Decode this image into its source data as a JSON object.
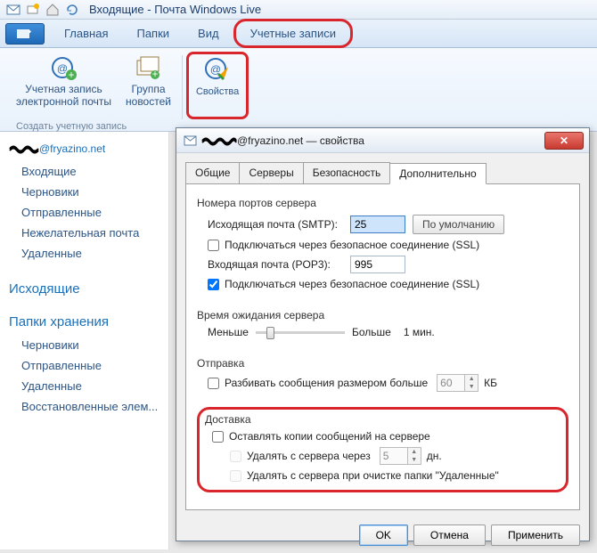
{
  "app_title": "Входящие - Почта Windows Live",
  "tabs": {
    "home": "Главная",
    "folders": "Папки",
    "view": "Вид",
    "accounts": "Учетные записи"
  },
  "ribbon": {
    "email_account": "Учетная запись\nэлектронной почты",
    "newsgroup": "Группа\nновостей",
    "properties": "Свойства",
    "group_title": "Создать учетную запись"
  },
  "sidebar": {
    "account": "@fryazino.net",
    "inbox": "Входящие",
    "drafts": "Черновики",
    "sent": "Отправленные",
    "junk": "Нежелательная почта",
    "deleted": "Удаленные",
    "outbox_section": "Исходящие",
    "storage_section": "Папки хранения",
    "s_drafts": "Черновики",
    "s_sent": "Отправленные",
    "s_deleted": "Удаленные",
    "s_restored": "Восстановленные элем..."
  },
  "dialog": {
    "title": "@fryazino.net — свойства",
    "tabs": {
      "general": "Общие",
      "servers": "Серверы",
      "security": "Безопасность",
      "advanced": "Дополнительно"
    },
    "ports_legend": "Номера портов сервера",
    "smtp_label": "Исходящая почта (SMTP):",
    "smtp_value": "25",
    "default_btn": "По умолчанию",
    "smtp_ssl": "Подключаться через безопасное соединение (SSL)",
    "pop_label": "Входящая почта (POP3):",
    "pop_value": "995",
    "pop_ssl": "Подключаться через безопасное соединение (SSL)",
    "timeout_legend": "Время ожидания сервера",
    "timeout_less": "Меньше",
    "timeout_more": "Больше",
    "timeout_value": "1 мин.",
    "send_legend": "Отправка",
    "split_label": "Разбивать сообщения размером больше",
    "split_value": "60",
    "split_unit": "КБ",
    "delivery_legend": "Доставка",
    "leave_copy": "Оставлять копии сообщений на сервере",
    "remove_after": "Удалять с сервера через",
    "remove_after_value": "5",
    "remove_after_unit": "дн.",
    "remove_on_delete": "Удалять с сервера при очистке папки \"Удаленные\"",
    "ok": "OK",
    "cancel": "Отмена",
    "apply": "Применить"
  }
}
